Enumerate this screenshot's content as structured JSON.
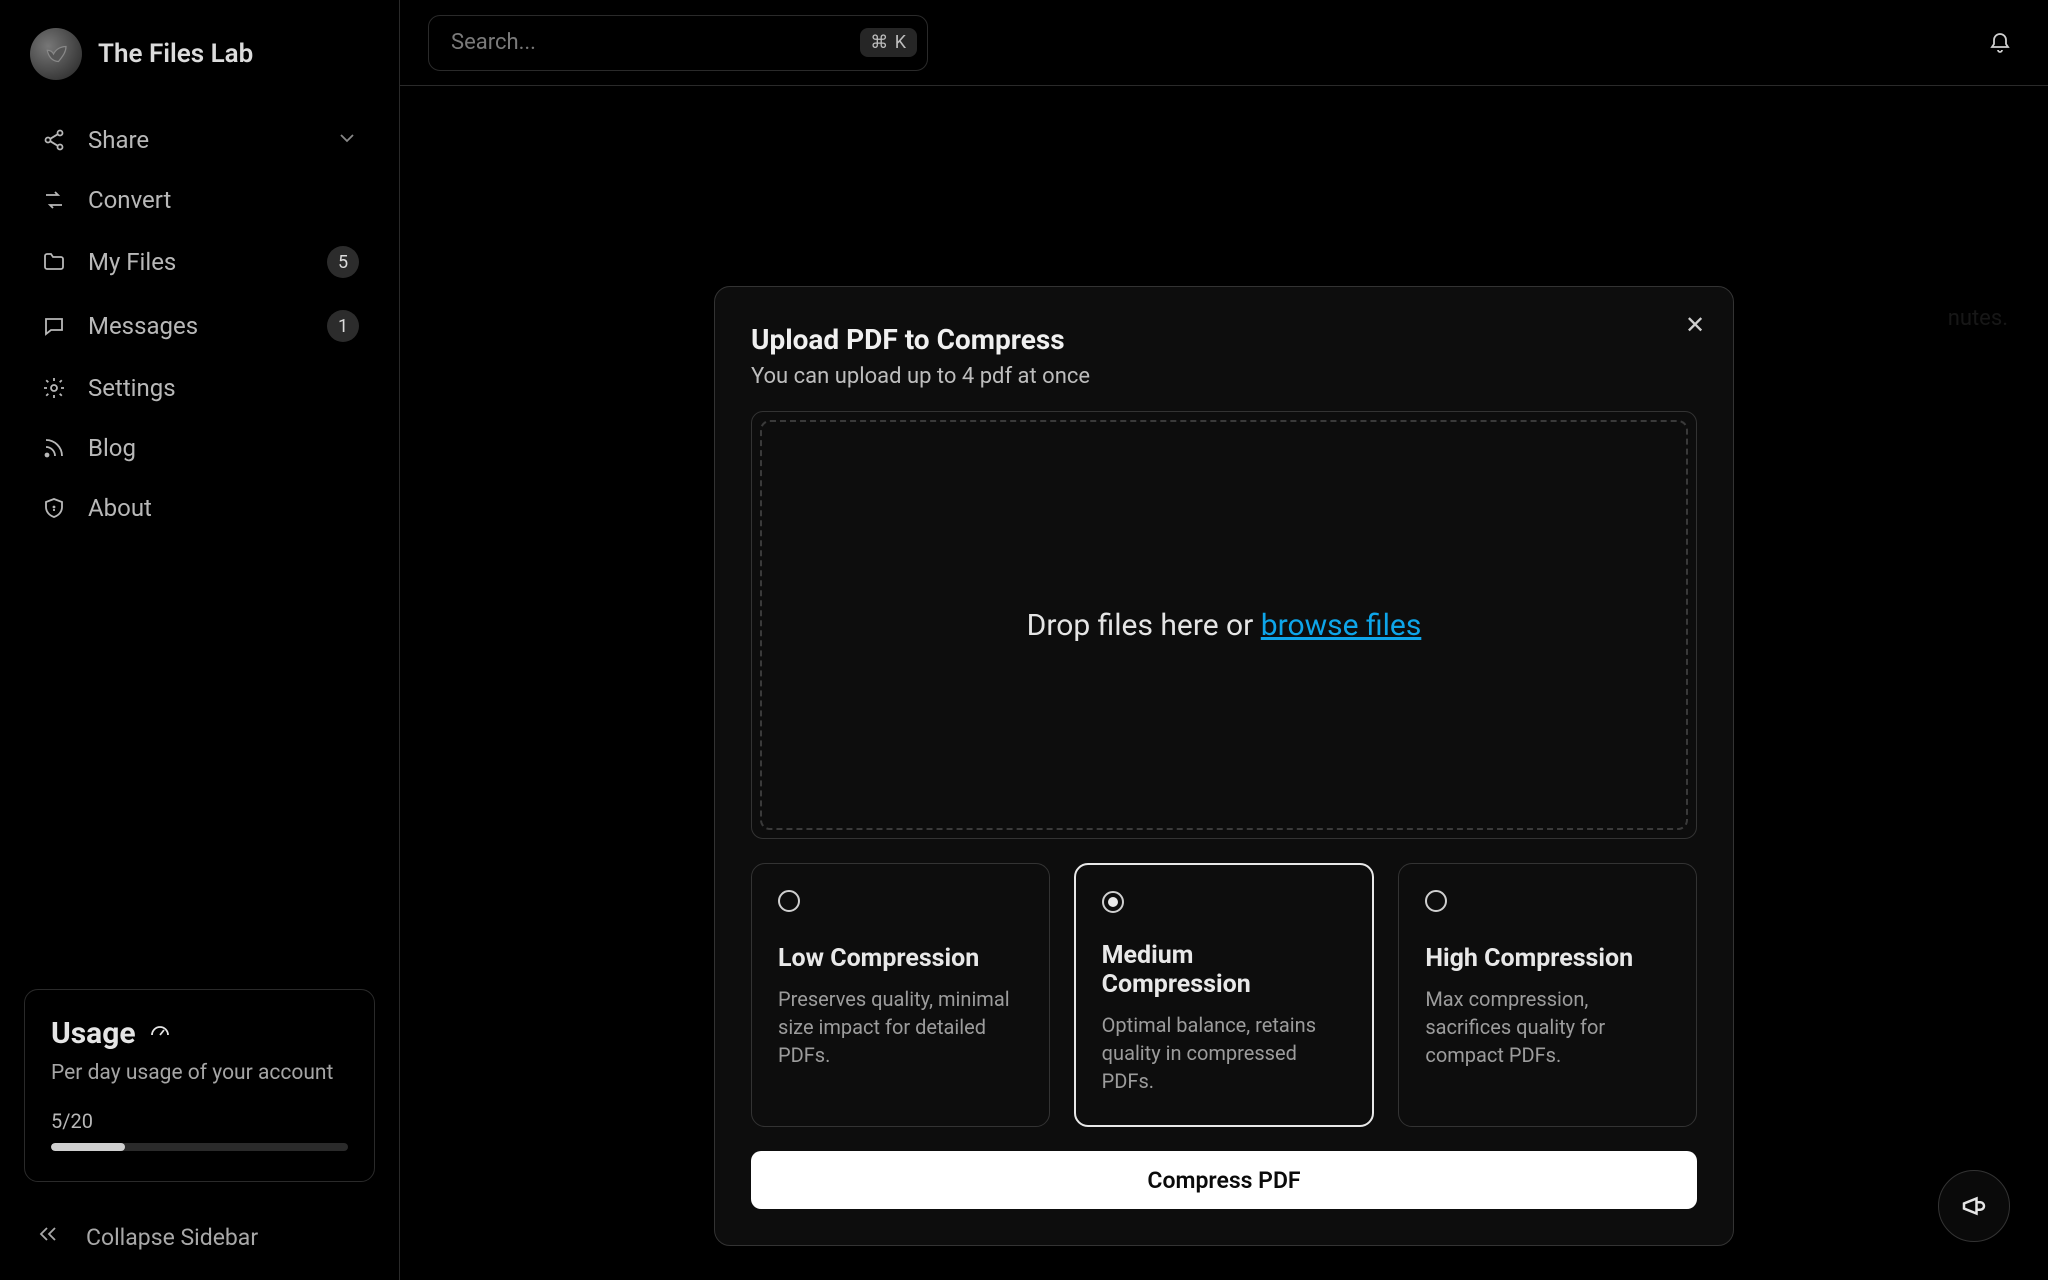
{
  "brand": {
    "name": "The Files Lab"
  },
  "search": {
    "placeholder": "Search...",
    "shortcut": "⌘ K"
  },
  "sidebar": {
    "items": [
      {
        "label": "Share",
        "icon": "share-icon",
        "chevron": true
      },
      {
        "label": "Convert",
        "icon": "convert-icon"
      },
      {
        "label": "My Files",
        "icon": "folder-icon",
        "badge": "5"
      },
      {
        "label": "Messages",
        "icon": "message-icon",
        "badge": "1"
      },
      {
        "label": "Settings",
        "icon": "gear-icon"
      },
      {
        "label": "Blog",
        "icon": "rss-icon"
      },
      {
        "label": "About",
        "icon": "shield-icon"
      }
    ],
    "collapse": "Collapse Sidebar"
  },
  "usage": {
    "title": "Usage",
    "subtitle": "Per day usage of your account",
    "count": "5/20",
    "percent": 25
  },
  "background_hint": "nutes.",
  "modal": {
    "title": "Upload PDF to Compress",
    "subtitle": "You can upload up to 4 pdf at once",
    "drop_prefix": "Drop files here or ",
    "browse": "browse files",
    "options": [
      {
        "title": "Low Compression",
        "desc": "Preserves quality, minimal size impact for detailed PDFs.",
        "selected": false
      },
      {
        "title": "Medium Compression",
        "desc": "Optimal balance, retains quality in compressed PDFs.",
        "selected": true
      },
      {
        "title": "High Compression",
        "desc": "Max compression, sacrifices quality for compact PDFs.",
        "selected": false
      }
    ],
    "submit": "Compress PDF"
  }
}
